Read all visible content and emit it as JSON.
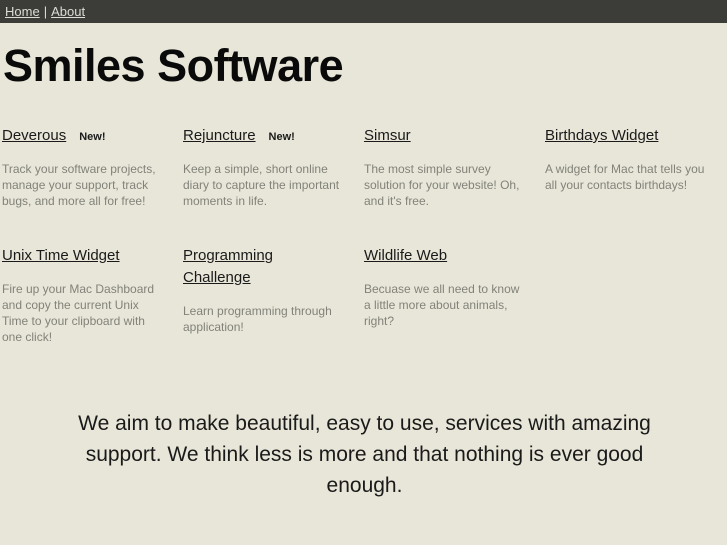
{
  "nav": {
    "links": [
      {
        "label": "Home"
      },
      {
        "label": "About"
      }
    ],
    "separator": "|"
  },
  "header": {
    "title": "Smiles Software"
  },
  "products": {
    "row1": [
      {
        "title": "Deverous",
        "badge": "New!",
        "description": "Track your software projects, manage your support, track bugs, and more all for free!"
      },
      {
        "title": "Rejuncture",
        "badge": "New!",
        "description": "Keep a simple, short online diary to capture the important moments in life."
      },
      {
        "title": "Simsur",
        "badge": "",
        "description": "The most simple survey solution for your website! Oh, and it's free."
      },
      {
        "title": "Birthdays Widget",
        "badge": "",
        "description": "A widget for Mac that tells you all your contacts birthdays!"
      }
    ],
    "row2": [
      {
        "title": "Unix Time Widget",
        "badge": "",
        "description": "Fire up your Mac Dashboard and copy the current Unix Time to your clipboard with one click!"
      },
      {
        "title": "Programming Challenge",
        "badge": "",
        "description": "Learn programming through application!"
      },
      {
        "title": "Wildlife Web",
        "badge": "",
        "description": "Becuase we all need to know a little more about animals, right?"
      }
    ]
  },
  "footer": {
    "tagline": "We aim to make beautiful, easy to use, services with amazing support. We think less is more and that nothing is ever good enough."
  },
  "colors": {
    "navbar_background": "#3c3c39",
    "page_background": "#e8e6d8",
    "heading_text": "#0a0a0a",
    "description_text": "#82827a",
    "nav_link": "#ddddd6"
  }
}
